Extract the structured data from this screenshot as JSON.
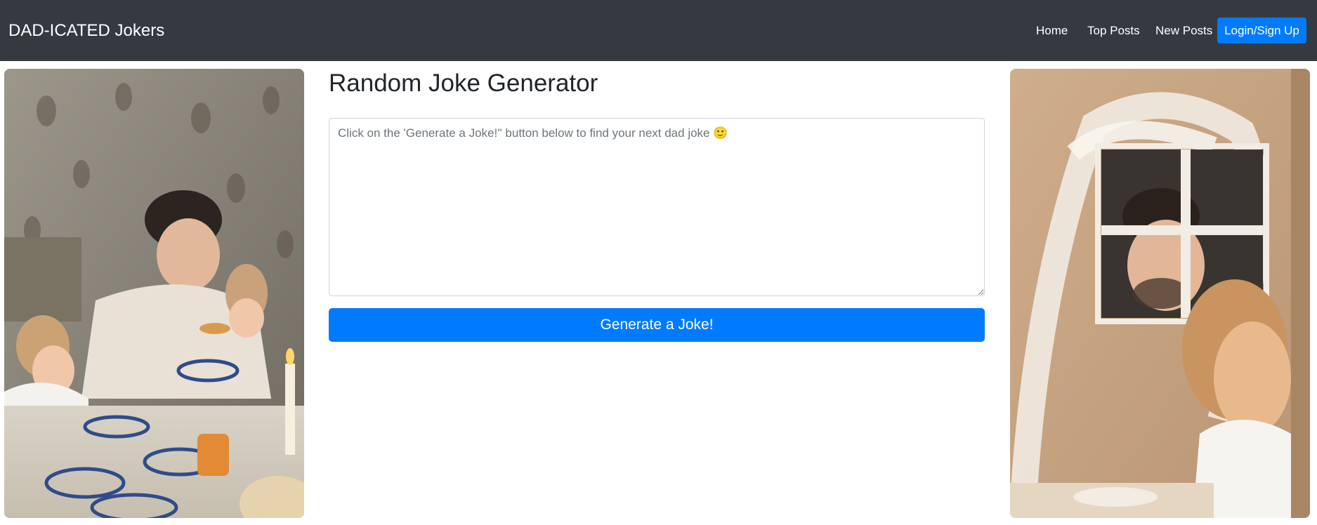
{
  "navbar": {
    "brand": "DAD-ICATED Jokers",
    "links": [
      "Home",
      "Top Posts",
      "New Posts"
    ],
    "login_label": "Login/Sign Up"
  },
  "main": {
    "title": "Random Joke Generator",
    "joke_placeholder": "Click on the 'Generate a Joke!'' button below to find your next dad joke 🙂",
    "joke_value": "",
    "generate_label": "Generate a Joke!"
  },
  "images": {
    "left": "photo: father and children eating at breakfast table",
    "right": "photo: father looking through cardboard window at child"
  },
  "colors": {
    "navbar_bg": "#343a40",
    "primary": "#007bff"
  }
}
